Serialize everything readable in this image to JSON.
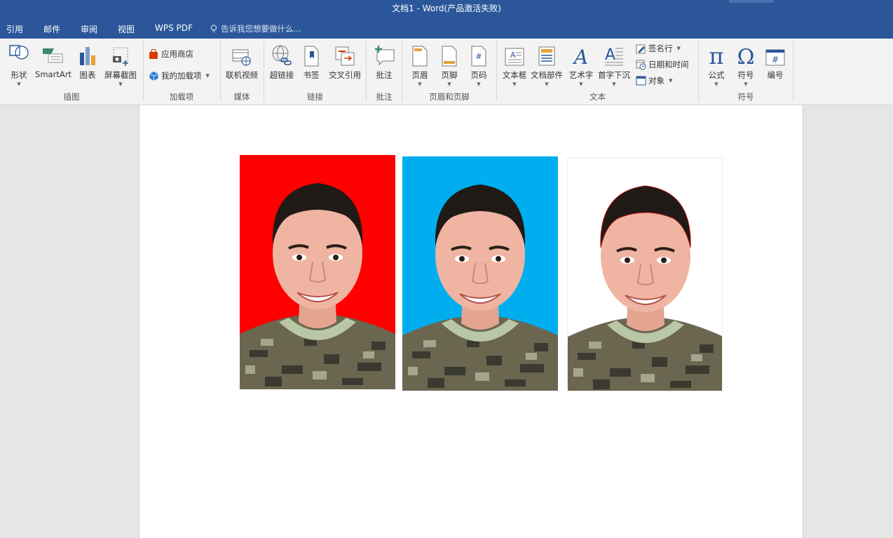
{
  "window": {
    "title": "文档1 - Word(产品激活失败)"
  },
  "tabs": [
    "引用",
    "邮件",
    "审阅",
    "视图",
    "WPS PDF"
  ],
  "tell_me": {
    "placeholder": "告诉我您想要做什么..."
  },
  "ribbon": {
    "illustrations": {
      "label": "插图",
      "shapes": "形状",
      "smartart": "SmartArt",
      "chart": "图表",
      "screenshot": "屏幕截图"
    },
    "addins": {
      "label": "加载项",
      "store": "应用商店",
      "my_addins": "我的加载项"
    },
    "media": {
      "label": "媒体",
      "online_video": "联机视频"
    },
    "links": {
      "label": "链接",
      "hyperlink": "超链接",
      "bookmark": "书签",
      "cross_ref": "交叉引用"
    },
    "comments": {
      "label": "批注",
      "comment": "批注"
    },
    "header_footer": {
      "label": "页眉和页脚",
      "header": "页眉",
      "footer": "页脚",
      "page_number": "页码"
    },
    "text": {
      "label": "文本",
      "text_box": "文本框",
      "quick_parts": "文档部件",
      "wordart": "艺术字",
      "drop_cap": "首字下沉",
      "signature": "签名行",
      "date_time": "日期和时间",
      "object": "对象"
    },
    "symbols": {
      "label": "符号",
      "equation": "公式",
      "symbol": "符号",
      "number": "编号"
    }
  },
  "document": {
    "photos": [
      {
        "background": "#ff0000"
      },
      {
        "background": "#00aeef"
      },
      {
        "background": "#ffffff"
      }
    ]
  },
  "colors": {
    "title_bar": "#2b579a",
    "ribbon": "#f3f3f3",
    "icon_blue": "#2b579a"
  }
}
